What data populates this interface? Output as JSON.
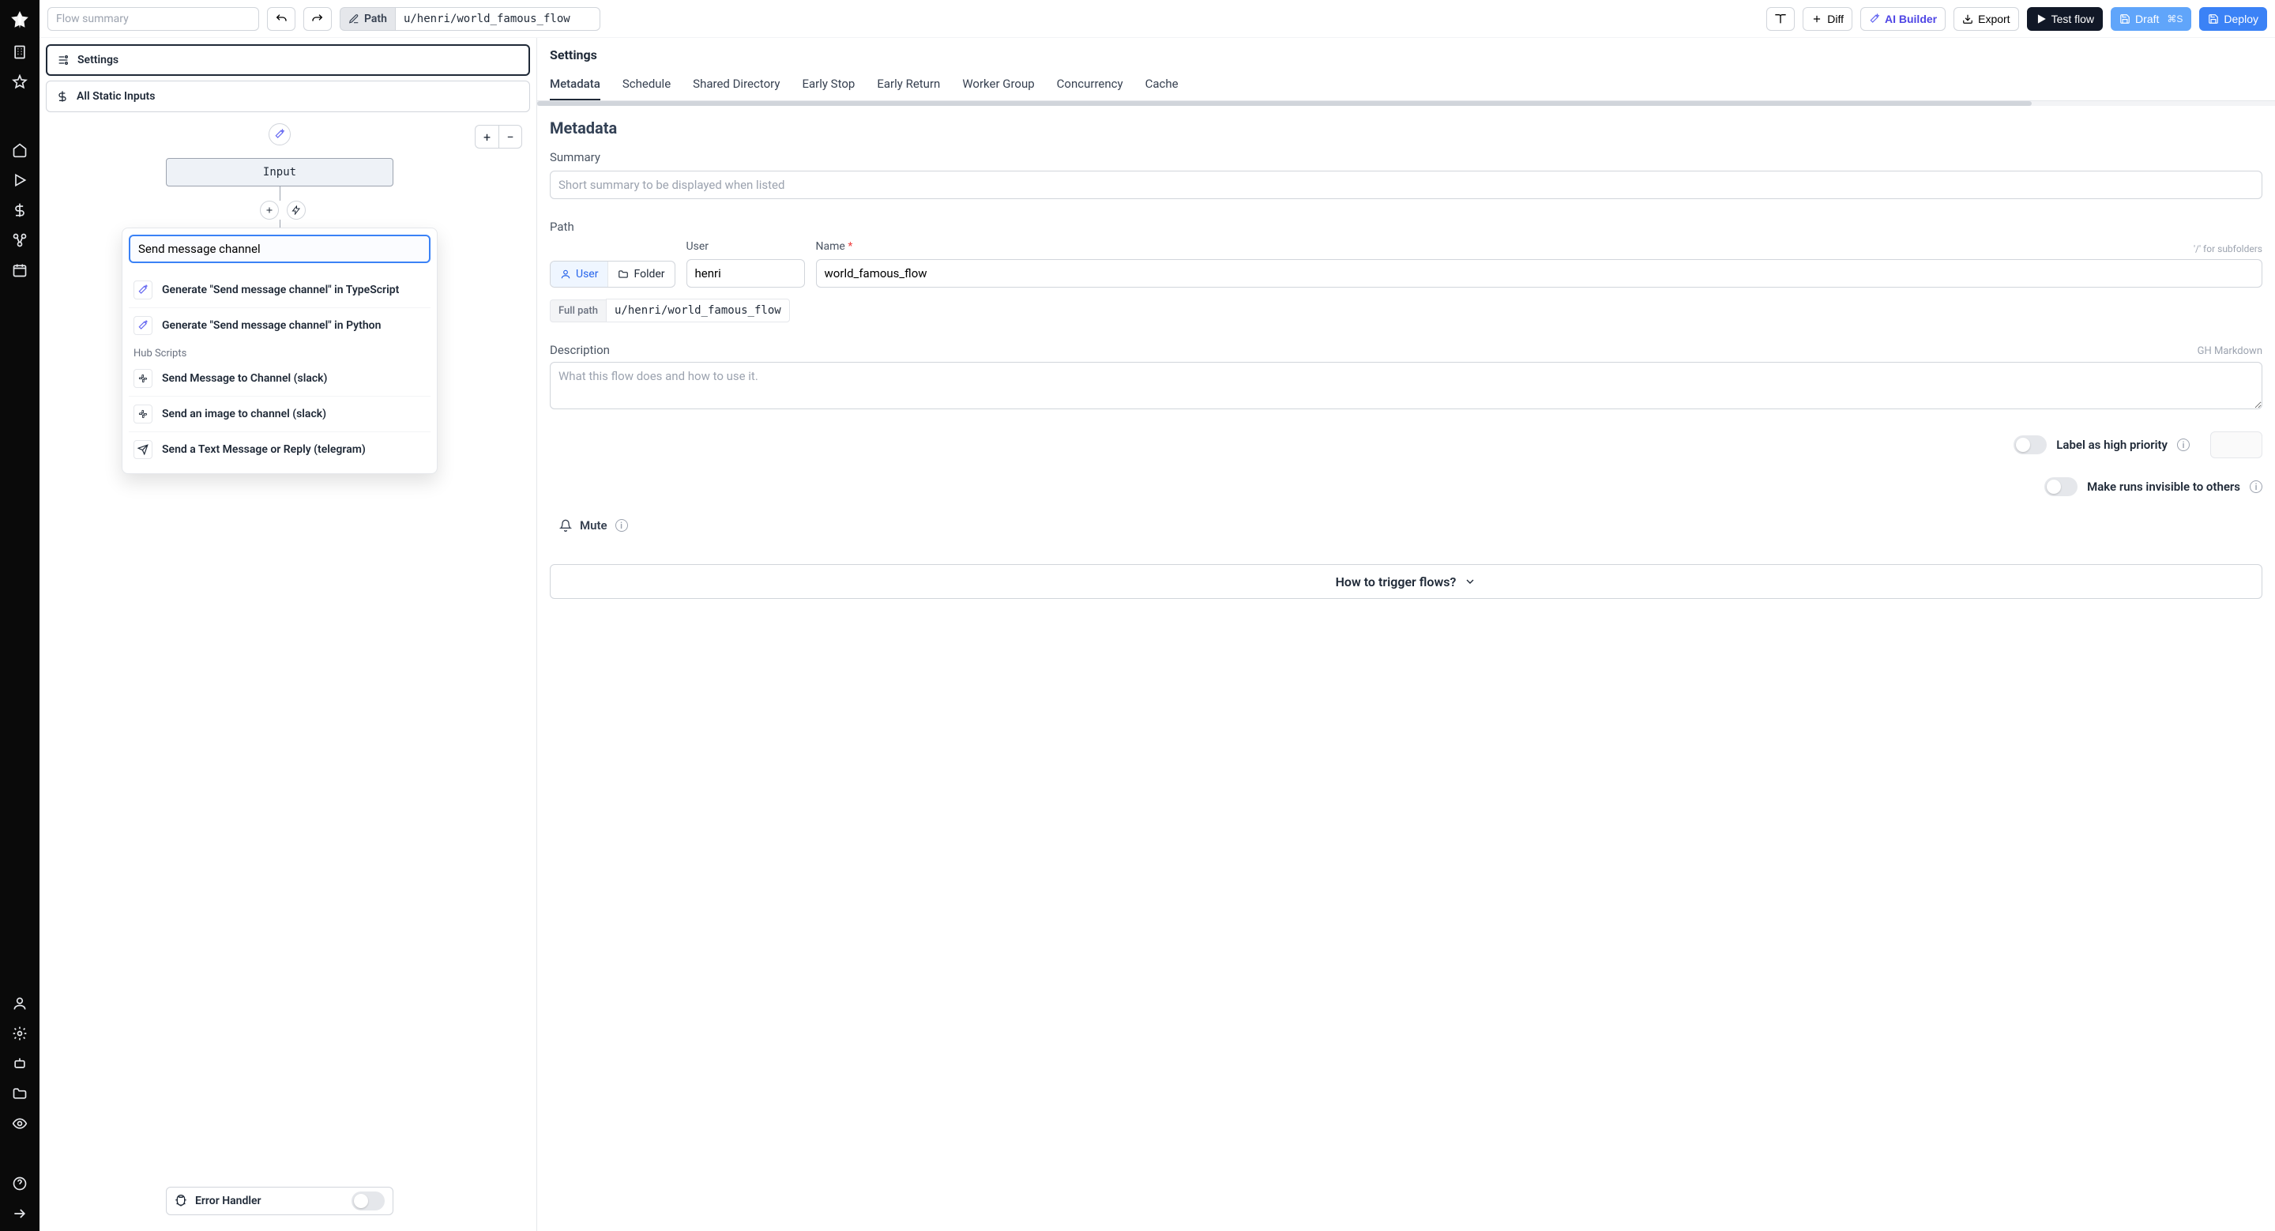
{
  "topbar": {
    "summary_placeholder": "Flow summary",
    "path_label": "Path",
    "path_value": "u/henri/world_famous_flow",
    "diff": "Diff",
    "ai_builder": "AI Builder",
    "export": "Export",
    "test_flow": "Test flow",
    "draft": "Draft",
    "draft_kbd": "⌘S",
    "deploy": "Deploy"
  },
  "canvas": {
    "settings": "Settings",
    "all_static_inputs": "All Static Inputs",
    "input_node": "Input",
    "error_handler": "Error Handler"
  },
  "dropdown": {
    "search_value": "Send message channel",
    "gen_ts": "Generate \"Send message channel\" in TypeScript",
    "gen_py": "Generate \"Send message channel\" in Python",
    "hub_heading": "Hub Scripts",
    "hub_1": "Send Message to Channel (slack)",
    "hub_2": "Send an image to channel (slack)",
    "hub_3": "Send a Text Message or Reply (telegram)"
  },
  "settings": {
    "title": "Settings",
    "tabs": {
      "metadata": "Metadata",
      "schedule": "Schedule",
      "shared_directory": "Shared Directory",
      "early_stop": "Early Stop",
      "early_return": "Early Return",
      "worker_group": "Worker Group",
      "concurrency": "Concurrency",
      "cache": "Cache"
    },
    "metadata_heading": "Metadata",
    "summary_label": "Summary",
    "summary_placeholder": "Short summary to be displayed when listed",
    "path_label": "Path",
    "user_label": "User",
    "name_label": "Name",
    "subfolder_hint": "'/' for subfolders",
    "seg_user": "User",
    "seg_folder": "Folder",
    "user_value": "henri",
    "name_value": "world_famous_flow",
    "full_path_label": "Full path",
    "full_path_value": "u/henri/world_famous_flow",
    "description_label": "Description",
    "gh_markdown": "GH Markdown",
    "description_placeholder": "What this flow does and how to use it.",
    "priority_label": "Label as high priority",
    "invisible_label": "Make runs invisible to others",
    "mute_label": "Mute",
    "trigger_label": "How to trigger flows?"
  }
}
